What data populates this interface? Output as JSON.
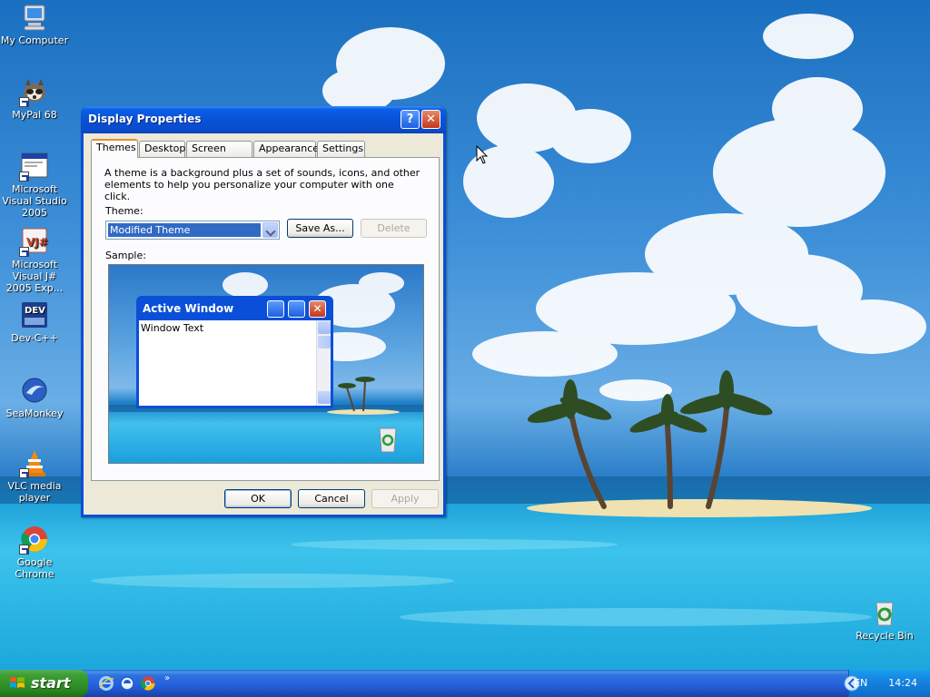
{
  "desktop": {
    "icons": [
      {
        "label": "My Computer"
      },
      {
        "label": "MyPal 68"
      },
      {
        "label": "Microsoft Visual Studio 2005"
      },
      {
        "label": "Microsoft Visual J# 2005 Exp..."
      },
      {
        "label": "Dev-C++"
      },
      {
        "label": "SeaMonkey"
      },
      {
        "label": "VLC media player"
      },
      {
        "label": "Google Chrome"
      },
      {
        "label": "Recycle Bin"
      }
    ]
  },
  "dialog": {
    "title": "Display Properties",
    "help_glyph": "?",
    "close_glyph": "✕",
    "tabs": [
      {
        "label": "Themes"
      },
      {
        "label": "Desktop"
      },
      {
        "label": "Screen Saver"
      },
      {
        "label": "Appearance"
      },
      {
        "label": "Settings"
      }
    ],
    "active_tab": "Themes",
    "description": "A theme is a background plus a set of sounds, icons, and other elements to help you personalize your computer with one click.",
    "theme_label": "Theme:",
    "theme_value": "Modified Theme",
    "save_as": "Save As...",
    "delete": "Delete",
    "sample_label": "Sample:",
    "sample": {
      "window_title": "Active Window",
      "window_text": "Window Text",
      "close_glyph": "✕"
    },
    "ok": "OK",
    "cancel": "Cancel",
    "apply": "Apply"
  },
  "taskbar": {
    "start": "start",
    "quick_launch": [
      "internet-explorer-icon",
      "ie-alt-icon",
      "chrome-icon"
    ],
    "overflow": "»",
    "language": "EN",
    "clock": "14:24"
  },
  "colors": {
    "title_blue": "#0a4fd8",
    "start_green": "#3c9f33",
    "selection": "#316ac5",
    "tab_highlight": "#e68b2c"
  }
}
